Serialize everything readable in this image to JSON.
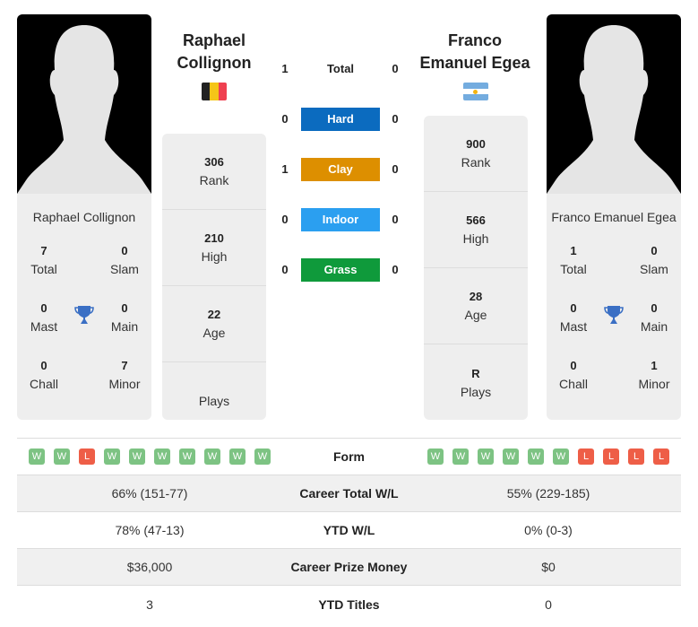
{
  "player1": {
    "name_heading": [
      "Raphael",
      "Collignon"
    ],
    "name": "Raphael Collignon",
    "country": "Belgium",
    "flag_colors": [
      "#222222",
      "#f5c518",
      "#ef4050"
    ],
    "titles": {
      "total": {
        "value": "7",
        "label": "Total"
      },
      "slam": {
        "value": "0",
        "label": "Slam"
      },
      "mast": {
        "value": "0",
        "label": "Mast"
      },
      "main": {
        "value": "0",
        "label": "Main"
      },
      "chall": {
        "value": "0",
        "label": "Chall"
      },
      "minor": {
        "value": "7",
        "label": "Minor"
      }
    },
    "stats": [
      {
        "value": "306",
        "label": "Rank"
      },
      {
        "value": "210",
        "label": "High"
      },
      {
        "value": "22",
        "label": "Age"
      },
      {
        "value": "",
        "label": "Plays"
      }
    ],
    "form": [
      "W",
      "W",
      "L",
      "W",
      "W",
      "W",
      "W",
      "W",
      "W",
      "W"
    ]
  },
  "player2": {
    "name_heading": [
      "Franco",
      "Emanuel Egea"
    ],
    "name": "Franco Emanuel Egea",
    "country": "Argentina",
    "flag_colors": [
      "#74acdf",
      "#ffffff",
      "#f6b40e"
    ],
    "titles": {
      "total": {
        "value": "1",
        "label": "Total"
      },
      "slam": {
        "value": "0",
        "label": "Slam"
      },
      "mast": {
        "value": "0",
        "label": "Mast"
      },
      "main": {
        "value": "0",
        "label": "Main"
      },
      "chall": {
        "value": "0",
        "label": "Chall"
      },
      "minor": {
        "value": "1",
        "label": "Minor"
      }
    },
    "stats": [
      {
        "value": "900",
        "label": "Rank"
      },
      {
        "value": "566",
        "label": "High"
      },
      {
        "value": "28",
        "label": "Age"
      },
      {
        "value": "R",
        "label": "Plays"
      }
    ],
    "form": [
      "W",
      "W",
      "W",
      "W",
      "W",
      "W",
      "L",
      "L",
      "L",
      "L"
    ]
  },
  "h2h": [
    {
      "label": "Total",
      "p1": "1",
      "p2": "0",
      "color": null
    },
    {
      "label": "Hard",
      "p1": "0",
      "p2": "0",
      "color": "#0b6bbf"
    },
    {
      "label": "Clay",
      "p1": "1",
      "p2": "0",
      "color": "#dd8f00"
    },
    {
      "label": "Indoor",
      "p1": "0",
      "p2": "0",
      "color": "#2b9ff0"
    },
    {
      "label": "Grass",
      "p1": "0",
      "p2": "0",
      "color": "#0f9a3b"
    }
  ],
  "comparison": {
    "form_label": "Form",
    "rows": [
      {
        "label": "Career Total W/L",
        "p1": "66% (151-77)",
        "p2": "55% (229-185)"
      },
      {
        "label": "YTD W/L",
        "p1": "78% (47-13)",
        "p2": "0% (0-3)"
      },
      {
        "label": "Career Prize Money",
        "p1": "$36,000",
        "p2": "$0"
      },
      {
        "label": "YTD Titles",
        "p1": "3",
        "p2": "0"
      }
    ]
  },
  "colors": {
    "trophy": "#3a6fc4",
    "win": "#7dc383",
    "loss": "#ee5e47"
  }
}
